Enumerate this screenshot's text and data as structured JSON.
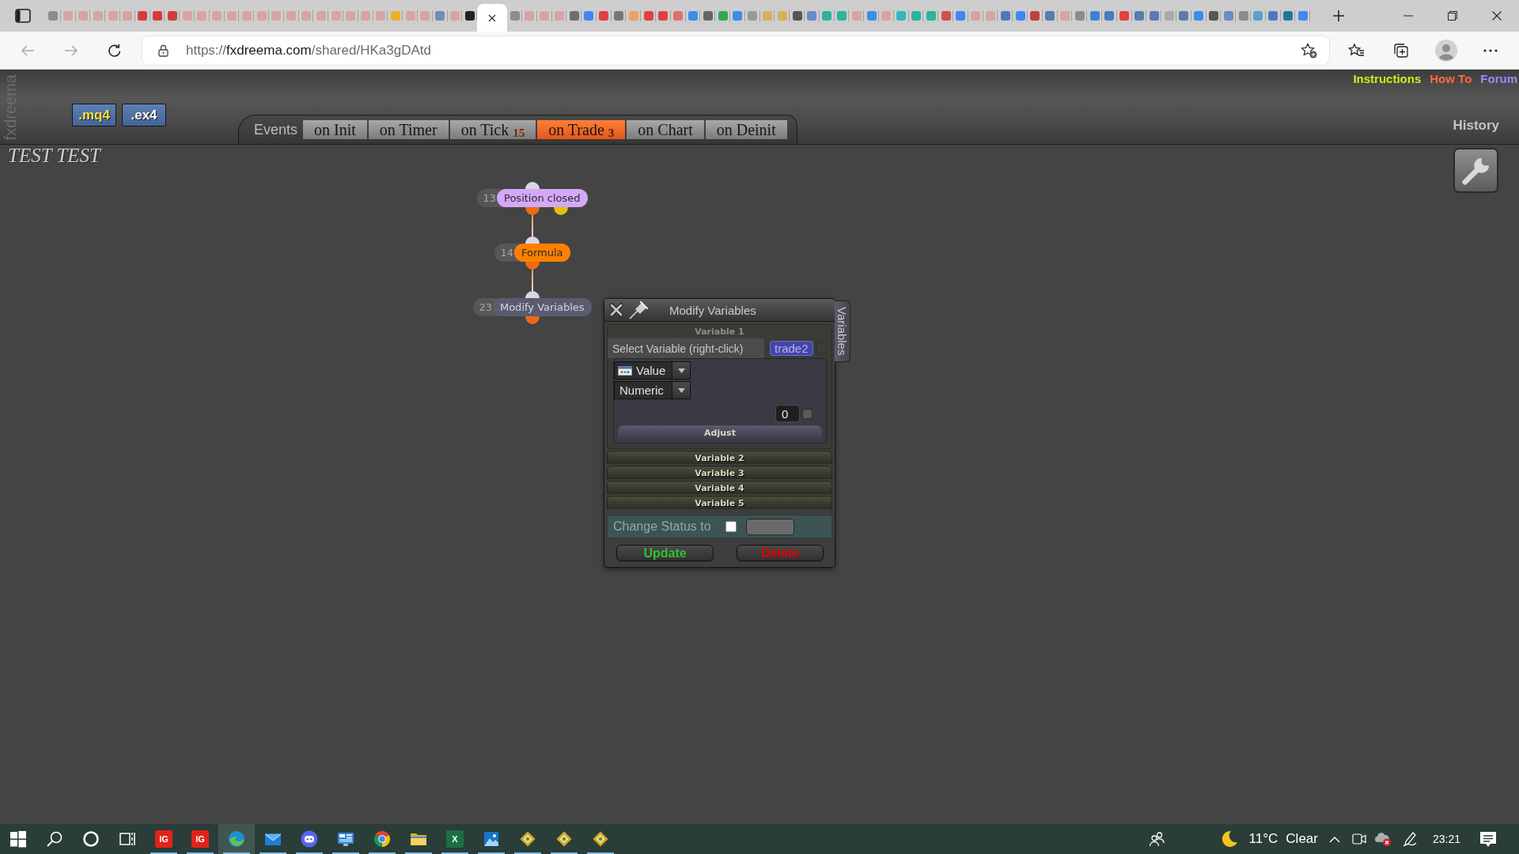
{
  "browser": {
    "tabs": [
      {
        "color": "#8c8c8c",
        "selected": false
      },
      {
        "color": "#d9a3a3",
        "selected": false
      },
      {
        "color": "#d9a3a3",
        "selected": false
      },
      {
        "color": "#d9a3a3",
        "selected": false
      },
      {
        "color": "#d9a3a3",
        "selected": false
      },
      {
        "color": "#d9a3a3",
        "selected": false
      },
      {
        "color": "#d43c3c",
        "selected": false
      },
      {
        "color": "#d43c3c",
        "selected": false
      },
      {
        "color": "#d43c3c",
        "selected": false
      },
      {
        "color": "#d9a3a3",
        "selected": false
      },
      {
        "color": "#d9a3a3",
        "selected": false
      },
      {
        "color": "#d9a3a3",
        "selected": false
      },
      {
        "color": "#d9a3a3",
        "selected": false
      },
      {
        "color": "#d9a3a3",
        "selected": false
      },
      {
        "color": "#d9a3a3",
        "selected": false
      },
      {
        "color": "#d9a3a3",
        "selected": false
      },
      {
        "color": "#d9a3a3",
        "selected": false
      },
      {
        "color": "#d9a3a3",
        "selected": false
      },
      {
        "color": "#d9a3a3",
        "selected": false
      },
      {
        "color": "#d9a3a3",
        "selected": false
      },
      {
        "color": "#d9a3a3",
        "selected": false
      },
      {
        "color": "#d9a3a3",
        "selected": false
      },
      {
        "color": "#d9a3a3",
        "selected": false
      },
      {
        "color": "#e8b030",
        "selected": false
      },
      {
        "color": "#d9a3a3",
        "selected": false
      },
      {
        "color": "#d9a3a3",
        "selected": false
      },
      {
        "color": "#6f8fb0",
        "selected": false
      },
      {
        "color": "#d9a3a3",
        "selected": false
      },
      {
        "color": "#222222",
        "selected": false
      },
      {
        "selected": true
      },
      {
        "color": "#8c8c8c",
        "selected": false
      },
      {
        "color": "#d9a3a3",
        "selected": false
      },
      {
        "color": "#d9a3a3",
        "selected": false
      },
      {
        "color": "#d9a3a3",
        "selected": false
      },
      {
        "color": "#6e6e6e",
        "selected": false
      },
      {
        "color": "#4285f4",
        "selected": false
      },
      {
        "color": "#e04040",
        "selected": false
      },
      {
        "color": "#777777",
        "selected": false
      },
      {
        "color": "#f0a060",
        "selected": false
      },
      {
        "color": "#e04040",
        "selected": false
      },
      {
        "color": "#e04040",
        "selected": false
      },
      {
        "color": "#e07070",
        "selected": false
      },
      {
        "color": "#3a8ee6",
        "selected": false
      },
      {
        "color": "#666666",
        "selected": false
      },
      {
        "color": "#33a852",
        "selected": false
      },
      {
        "color": "#3a8ee6",
        "selected": false
      },
      {
        "color": "#999999",
        "selected": false
      },
      {
        "color": "#d9b05a",
        "selected": false
      },
      {
        "color": "#d9b05a",
        "selected": false
      },
      {
        "color": "#555555",
        "selected": false
      },
      {
        "color": "#6a8cc8",
        "selected": false
      },
      {
        "color": "#2bb3a0",
        "selected": false
      },
      {
        "color": "#2bb3a0",
        "selected": false
      },
      {
        "color": "#d9a3a3",
        "selected": false
      },
      {
        "color": "#3a8ee6",
        "selected": false
      },
      {
        "color": "#d9a3a3",
        "selected": false
      },
      {
        "color": "#35b5c5",
        "selected": false
      },
      {
        "color": "#2bb3a0",
        "selected": false
      },
      {
        "color": "#2bb3a0",
        "selected": false
      },
      {
        "color": "#d05050",
        "selected": false
      },
      {
        "color": "#4285f4",
        "selected": false
      },
      {
        "color": "#d9a3a3",
        "selected": false
      },
      {
        "color": "#d9a3a3",
        "selected": false
      },
      {
        "color": "#4a7ac0",
        "selected": false
      },
      {
        "color": "#4285f4",
        "selected": false
      },
      {
        "color": "#c04040",
        "selected": false
      },
      {
        "color": "#5a7ab0",
        "selected": false
      },
      {
        "color": "#d9a3a3",
        "selected": false
      },
      {
        "color": "#8c8c8c",
        "selected": false
      },
      {
        "color": "#3b82d6",
        "selected": false
      },
      {
        "color": "#4a7ac0",
        "selected": false
      },
      {
        "color": "#e04040",
        "selected": false
      },
      {
        "color": "#5a7ab0",
        "selected": false
      },
      {
        "color": "#5a7ab0",
        "selected": false
      },
      {
        "color": "#aaaaaa",
        "selected": false
      },
      {
        "color": "#5a7ab0",
        "selected": false
      },
      {
        "color": "#3a8ee6",
        "selected": false
      },
      {
        "color": "#555555",
        "selected": false
      },
      {
        "color": "#6a8cc8",
        "selected": false
      },
      {
        "color": "#8c8c8c",
        "selected": false
      },
      {
        "color": "#5aa0d0",
        "selected": false
      },
      {
        "color": "#4a7ac0",
        "selected": false
      },
      {
        "color": "#21759b",
        "selected": false
      },
      {
        "color": "#4285f4",
        "selected": false
      }
    ],
    "address": {
      "scheme": "https://",
      "host": "fxdreema.com",
      "path": "/shared/HKa3gDAtd"
    }
  },
  "header": {
    "brand": "fxdreema",
    "file_buttons": [
      {
        "label": ".mq4",
        "kind": "source"
      },
      {
        "label": ".ex4",
        "kind": "compiled"
      }
    ],
    "events_label": "Events",
    "event_tabs": [
      {
        "label": "on Init",
        "selected": false
      },
      {
        "label": "on Timer",
        "selected": false
      },
      {
        "label": "on Tick",
        "count": "15",
        "selected": false
      },
      {
        "label": "on Trade",
        "count": "3",
        "selected": true
      },
      {
        "label": "on Chart",
        "selected": false
      },
      {
        "label": "on Deinit",
        "selected": false
      }
    ],
    "links": [
      {
        "label": "Instructions",
        "color": "#c6f01e"
      },
      {
        "label": "How To",
        "color": "#ff6a3a"
      },
      {
        "label": "Forum",
        "color": "#9a8cff"
      }
    ],
    "history": "History"
  },
  "project_title": "TEST TEST",
  "nodes": [
    {
      "number": "13",
      "label": "Position closed",
      "color": "#d4a8f8",
      "outputs": [
        {
          "color": "#f06a10"
        },
        {
          "color": "#e6c000"
        }
      ],
      "children": [
        {
          "number": "14",
          "label": "Formula",
          "color": "#ff8000",
          "outputs": [
            {
              "color": "#f06a10"
            }
          ],
          "children": [
            {
              "number": "23",
              "label": "Modify Variables",
              "color": "#5b5b6f",
              "outputs": [
                {
                  "color": "#f06a10"
                }
              ]
            }
          ]
        }
      ]
    }
  ],
  "dialog": {
    "title": "Modify Variables",
    "side_tab": "Variables",
    "variables": [
      {
        "title": "Variable 1",
        "expanded": true,
        "select_label": "Select Variable (right-click)",
        "variable": "trade2",
        "variable_checked": false,
        "source": "Value",
        "type": "Numeric",
        "number": "0",
        "number_checked": false,
        "adjust": "Adjust"
      },
      {
        "title": "Variable 2",
        "expanded": false
      },
      {
        "title": "Variable 3",
        "expanded": false
      },
      {
        "title": "Variable 4",
        "expanded": false
      },
      {
        "title": "Variable 5",
        "expanded": false
      }
    ],
    "status": {
      "label": "Change Status to",
      "checked": false
    },
    "buttons": [
      {
        "label": "Update",
        "color": "#33c033"
      },
      {
        "label": "Delete",
        "color": "#e00000"
      }
    ]
  },
  "taskbar": {
    "apps": [
      {
        "kind": "tile",
        "label": "IG",
        "color": "#e2231a",
        "running": true,
        "selected": false
      },
      {
        "kind": "tile",
        "label": "IG",
        "color": "#e2231a",
        "running": true,
        "selected": false
      },
      {
        "kind": "edge",
        "running": true,
        "selected": true
      },
      {
        "kind": "mail",
        "running": true,
        "selected": false
      },
      {
        "kind": "discord",
        "running": true,
        "selected": false
      },
      {
        "kind": "monitor",
        "running": true,
        "selected": false
      },
      {
        "kind": "chrome",
        "running": true,
        "selected": false
      },
      {
        "kind": "folder",
        "running": true,
        "selected": false
      },
      {
        "kind": "tile",
        "label": "X",
        "color": "#1d6f42",
        "running": true,
        "selected": false
      },
      {
        "kind": "photos",
        "running": true,
        "selected": false
      },
      {
        "kind": "diamond",
        "running": true,
        "selected": false
      },
      {
        "kind": "diamond",
        "running": true,
        "selected": false
      },
      {
        "kind": "diamond",
        "running": true,
        "selected": false
      }
    ],
    "weather": {
      "temperature": "11°C",
      "condition": "Clear"
    },
    "time": "23:21"
  }
}
